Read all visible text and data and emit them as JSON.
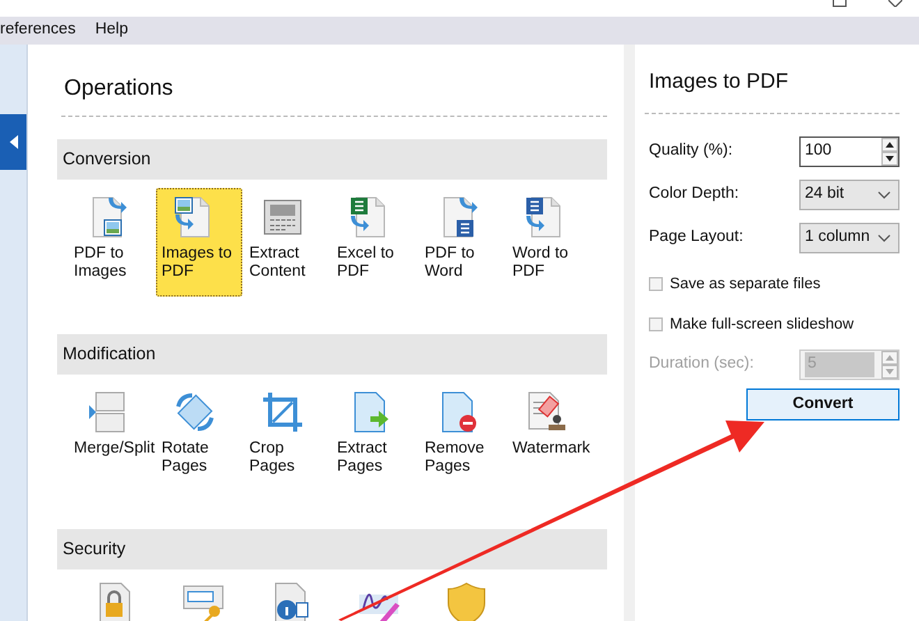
{
  "menu": [
    {
      "label": "references"
    },
    {
      "label": "Help"
    }
  ],
  "operations": {
    "title": "Operations",
    "groups": [
      {
        "title": "Conversion",
        "items": [
          {
            "label": "PDF to Images",
            "selected": false
          },
          {
            "label": "Images to PDF",
            "selected": true
          },
          {
            "label": "Extract Content",
            "selected": false
          },
          {
            "label": "Excel to PDF",
            "selected": false
          },
          {
            "label": "PDF to Word",
            "selected": false
          },
          {
            "label": "Word to PDF",
            "selected": false
          }
        ]
      },
      {
        "title": "Modification",
        "items": [
          {
            "label": "Merge/Split",
            "selected": false
          },
          {
            "label": "Rotate Pages",
            "selected": false
          },
          {
            "label": "Crop Pages",
            "selected": false
          },
          {
            "label": "Extract Pages",
            "selected": false
          },
          {
            "label": "Remove Pages",
            "selected": false
          },
          {
            "label": "Watermark",
            "selected": false
          }
        ]
      },
      {
        "title": "Security"
      }
    ]
  },
  "panel": {
    "title": "Images to PDF",
    "fields": [
      {
        "kind": "spin",
        "label": "Quality (%):",
        "value": "100",
        "disabled": false
      },
      {
        "kind": "select",
        "label": "Color Depth:",
        "value": "24 bit",
        "disabled": false
      },
      {
        "kind": "select",
        "label": "Page Layout:",
        "value": "1 column",
        "disabled": false
      }
    ],
    "checkboxes": [
      {
        "label": "Save as separate files",
        "checked": false
      },
      {
        "label": "Make full-screen slideshow",
        "checked": false
      }
    ],
    "duration": {
      "kind": "spin",
      "label": "Duration (sec):",
      "value": "5",
      "disabled": true
    },
    "button": "Convert"
  }
}
